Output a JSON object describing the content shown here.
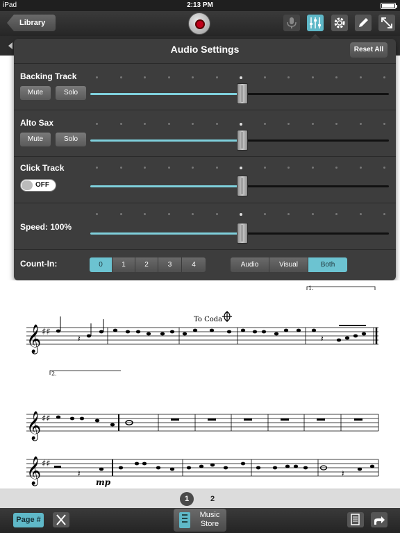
{
  "status_bar": {
    "device": "iPad",
    "time": "2:13 PM"
  },
  "top_bar": {
    "library_label": "Library",
    "icons": [
      "microphone-icon",
      "mixer-icon",
      "gear-icon",
      "pencil-icon",
      "expand-icon"
    ]
  },
  "audio_settings": {
    "title": "Audio Settings",
    "reset_label": "Reset All",
    "backing_track": {
      "label": "Backing Track",
      "mute_label": "Mute",
      "solo_label": "Solo",
      "level": 0.5
    },
    "alto_sax": {
      "label": "Alto Sax",
      "mute_label": "Mute",
      "solo_label": "Solo",
      "level": 0.5
    },
    "click_track": {
      "label": "Click Track",
      "toggle_label": "OFF",
      "level": 0.5
    },
    "speed": {
      "label": "Speed: 100%",
      "level": 0.5
    },
    "count_in": {
      "label": "Count-In:",
      "options": [
        "0",
        "1",
        "2",
        "3",
        "4"
      ],
      "selected": "0",
      "mode_options": [
        "Audio",
        "Visual",
        "Both"
      ],
      "selected_mode": "Both"
    }
  },
  "score": {
    "coda_text": "To Coda",
    "ending_1": "1.",
    "ending_2": "2.",
    "dynamic": "mp"
  },
  "pages": {
    "items": [
      "1",
      "2"
    ],
    "current": "1"
  },
  "bottom_bar": {
    "page_button_label": "Page #",
    "store_line1": "Music",
    "store_line2": "Store"
  },
  "colors": {
    "accent": "#5fb8c8",
    "slider_fill": "#7fd0dc",
    "panel": "#3d3d3d",
    "record": "#c0001a"
  }
}
